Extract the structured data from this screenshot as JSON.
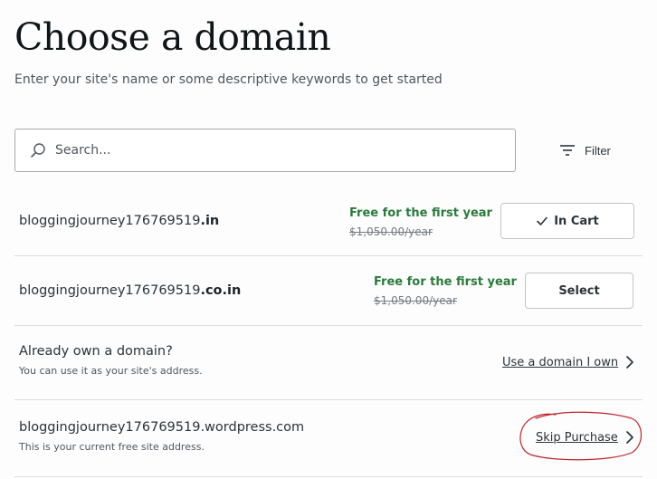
{
  "header": {
    "title": "Choose a domain",
    "subtitle": "Enter your site's name or some descriptive keywords to get started"
  },
  "search": {
    "placeholder": "Search...",
    "icon": "search-icon"
  },
  "filter": {
    "label": "Filter",
    "icon": "filter-icon"
  },
  "results": [
    {
      "name_base": "bloggingjourney176769519",
      "tld": ".in",
      "price_note": "Free for the first year",
      "original_price": "$1,050.00/year",
      "button_label": "In Cart",
      "button_icon": "checkmark-icon"
    },
    {
      "name_base": "bloggingjourney176769519",
      "tld": ".co.in",
      "price_note": "Free for the first year",
      "original_price": "$1,050.00/year",
      "button_label": "Select"
    }
  ],
  "own_domain": {
    "title": "Already own a domain?",
    "subtitle": "You can use it as your site's address.",
    "link_label": "Use a domain I own"
  },
  "free_domain": {
    "title": "bloggingjourney176769519.wordpress.com",
    "subtitle": "This is your current free site address.",
    "link_label": "Skip Purchase"
  },
  "colors": {
    "free_price": "#2a7a3b",
    "annotation_circle": "#c0242b",
    "border": "#c3c4c7"
  }
}
